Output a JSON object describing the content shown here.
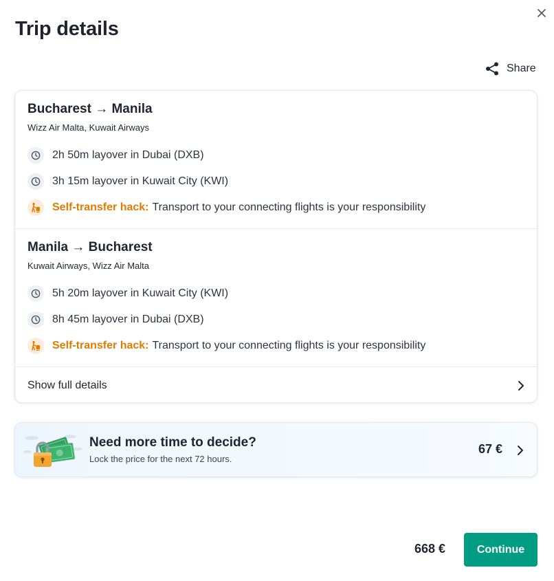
{
  "header": {
    "title": "Trip details",
    "close_icon": "close-icon",
    "share_label": "Share",
    "share_icon": "share-icon"
  },
  "legs": [
    {
      "route": "Bucharest → Manila",
      "airlines": "Wizz Air Malta, Kuwait Airways",
      "layovers": [
        "2h 50m layover in Dubai (DXB)",
        "3h 15m layover in Kuwait City (KWI)"
      ],
      "hack_label": "Self-transfer hack:",
      "hack_text": "Transport to your connecting flights is your responsibility"
    },
    {
      "route": "Manila → Bucharest",
      "airlines": "Kuwait Airways, Wizz Air Malta",
      "layovers": [
        "5h 20m layover in Kuwait City (KWI)",
        "8h 45m layover in Dubai (DXB)"
      ],
      "hack_label": "Self-transfer hack:",
      "hack_text": "Transport to your connecting flights is your responsibility"
    }
  ],
  "show_full_details": "Show full details",
  "price_lock": {
    "title": "Need more time to decide?",
    "subtitle": "Lock the price for the next 72 hours.",
    "price": "67 €"
  },
  "footer": {
    "total_price": "668 €",
    "continue_label": "Continue"
  },
  "colors": {
    "accent": "#009d84",
    "warning": "#e07b00"
  }
}
